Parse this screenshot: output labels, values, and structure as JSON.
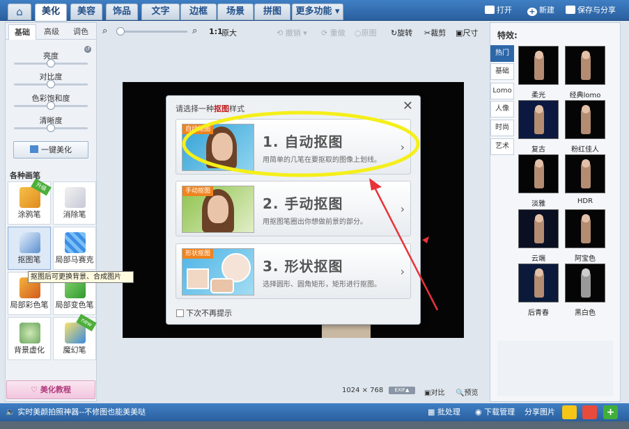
{
  "top_tabs": [
    "美化",
    "美容",
    "饰品",
    "文字",
    "边框",
    "场景",
    "拼图",
    "更多功能 ▾"
  ],
  "top_actions": {
    "open": "打开",
    "new": "新建",
    "save_share": "保存与分享"
  },
  "left_panel": {
    "tabs": [
      "基础",
      "高级",
      "调色"
    ],
    "sliders": [
      {
        "label": "亮度",
        "value": 0.5
      },
      {
        "label": "对比度",
        "value": 0.5
      },
      {
        "label": "色彩饱和度",
        "value": 0.5
      },
      {
        "label": "清晰度",
        "value": 0.5
      }
    ],
    "one_key": "一键美化",
    "section_title": "各种画笔",
    "tools": [
      {
        "label": "涂鸦笔",
        "badge": "升级"
      },
      {
        "label": "消除笔"
      },
      {
        "label": "抠图笔"
      },
      {
        "label": "局部马赛克"
      },
      {
        "label": "局部彩色笔"
      },
      {
        "label": "局部变色笔"
      },
      {
        "label": "背景虚化"
      },
      {
        "label": "魔幻笔",
        "badge": "new"
      }
    ],
    "tooltip": "抠图后可更换背景、合成图片",
    "tutorial": "美化教程"
  },
  "toolbar": {
    "zoom_label": "1:1",
    "original_size": "原大",
    "undo": "撤销",
    "redo": "重做",
    "original": "原图",
    "rotate": "旋转",
    "crop": "裁剪",
    "resize": "尺寸"
  },
  "dialog": {
    "title_prefix": "请选择一种",
    "title_red": "抠图",
    "title_suffix": "样式",
    "options": [
      {
        "tag": "自动抠图",
        "title": "1. 自动抠图",
        "desc": "用简单的几笔在要抠取的图像上划线。"
      },
      {
        "tag": "手动抠图",
        "title": "2. 手动抠图",
        "desc": "用抠图笔圈出你想做前景的部分。"
      },
      {
        "tag": "形状抠图",
        "title": "3. 形状抠图",
        "desc": "选择圆形、圆角矩形，矩形进行抠图。"
      }
    ],
    "checkbox": "下次不再提示"
  },
  "info": {
    "size": "1024 × 768",
    "exif": "EXIF▲",
    "compare": "对比",
    "preview": "预览"
  },
  "right_panel": {
    "title": "特效:",
    "tabs": [
      "热门",
      "基础",
      "Lomo",
      "人像",
      "时尚",
      "艺术"
    ],
    "effects": [
      "柔光",
      "经典lomo",
      "复古",
      "粉红佳人",
      "淡雅",
      "HDR",
      "云端",
      "阿宝色",
      "后青春",
      "黑白色"
    ]
  },
  "status": {
    "tip": "实时美颜拍照神器--不修图也能美美哒",
    "batch": "批处理",
    "download": "下载管理",
    "share": "分享图片"
  },
  "colors": {
    "accent": "#2a5f9e",
    "highlight": "#f5ef1a",
    "arrow": "#e8333a"
  }
}
